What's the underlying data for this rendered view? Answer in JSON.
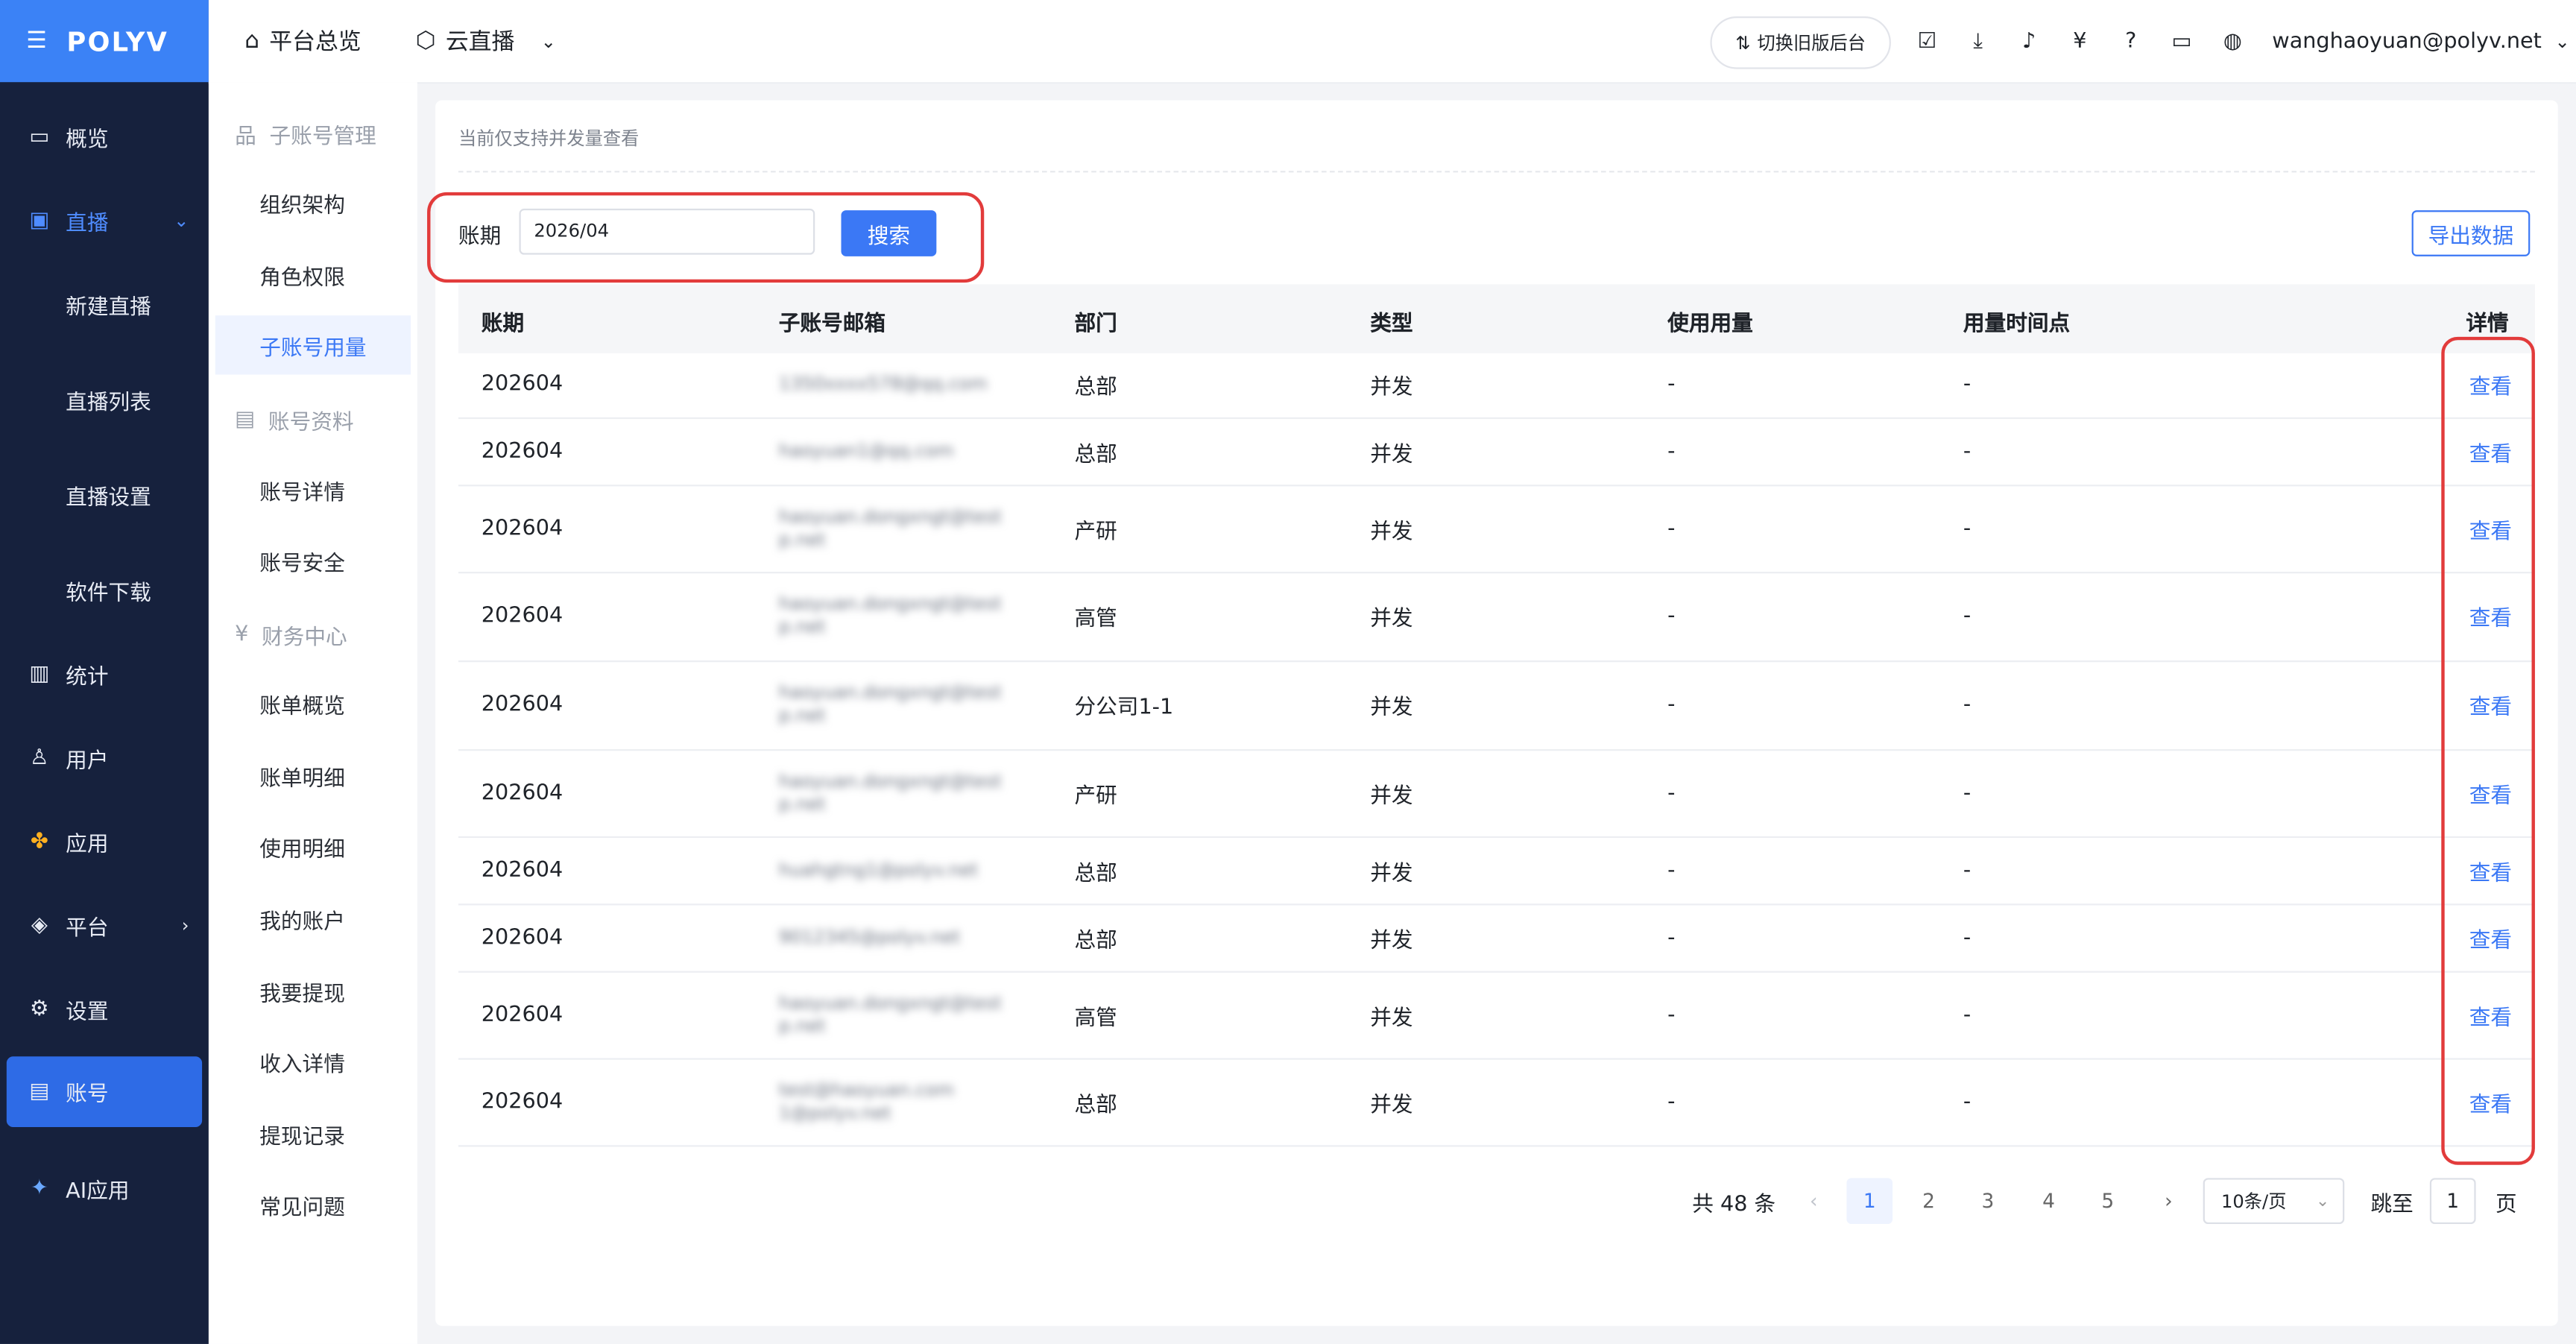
{
  "brand": {
    "logo": "POLYV",
    "menu_icon": "☰"
  },
  "sidebar": {
    "items": [
      {
        "label": "概览",
        "icon": "monitor-icon"
      },
      {
        "label": "直播",
        "icon": "video-icon"
      },
      {
        "label": "新建直播"
      },
      {
        "label": "直播列表"
      },
      {
        "label": "直播设置"
      },
      {
        "label": "软件下载"
      },
      {
        "label": "统计",
        "icon": "bar-chart-icon"
      },
      {
        "label": "用户",
        "icon": "user-icon"
      },
      {
        "label": "应用",
        "icon": "apps-icon"
      },
      {
        "label": "平台",
        "icon": "layers-icon"
      },
      {
        "label": "设置",
        "icon": "gear-icon"
      },
      {
        "label": "账号",
        "icon": "id-card-icon"
      },
      {
        "label": "AI应用",
        "icon": "sparkle-icon"
      }
    ]
  },
  "topbar": {
    "home_label": "平台总览",
    "product_label": "云直播",
    "switch_label": "切换旧版后台",
    "user_email": "wanghaoyuan@polyv.net"
  },
  "submenu": {
    "group1": "子账号管理",
    "group2": "账号资料",
    "group3": "财务中心",
    "items": [
      "组织架构",
      "角色权限",
      "子账号用量",
      "账号详情",
      "账号安全",
      "账单概览",
      "账单明细",
      "使用明细",
      "我的账户",
      "我要提现",
      "收入详情",
      "提现记录",
      "常见问题"
    ]
  },
  "main": {
    "notice": "当前仅支持并发量查看",
    "filter_label": "账期",
    "filter_value": "2026/04",
    "search_label": "搜索",
    "export_label": "导出数据",
    "columns": [
      "账期",
      "子账号邮箱",
      "部门",
      "类型",
      "使用用量",
      "用量时间点",
      "详情"
    ],
    "rows": [
      {
        "period": "202604",
        "email": "1350xxxx578@qq.com",
        "dept": "总部",
        "type": "并发",
        "usage": "-",
        "time": "-",
        "action": "查看"
      },
      {
        "period": "202604",
        "email": "haoyuan1@qq.com",
        "dept": "总部",
        "type": "并发",
        "usage": "-",
        "time": "-",
        "action": "查看"
      },
      {
        "period": "202604",
        "email": "haoyuan.dongxngt@test p.net",
        "dept": "产研",
        "type": "并发",
        "usage": "-",
        "time": "-",
        "action": "查看"
      },
      {
        "period": "202604",
        "email": "haoyuan.dongxngt@test p.net",
        "dept": "高管",
        "type": "并发",
        "usage": "-",
        "time": "-",
        "action": "查看"
      },
      {
        "period": "202604",
        "email": "haoyuan.dongxngt@test p.net",
        "dept": "分公司1-1",
        "type": "并发",
        "usage": "-",
        "time": "-",
        "action": "查看"
      },
      {
        "period": "202604",
        "email": "haoyuan.dongxngt@test p.net",
        "dept": "产研",
        "type": "并发",
        "usage": "-",
        "time": "-",
        "action": "查看"
      },
      {
        "period": "202604",
        "email": "huahgtng1@polyv.net",
        "dept": "总部",
        "type": "并发",
        "usage": "-",
        "time": "-",
        "action": "查看"
      },
      {
        "period": "202604",
        "email": "9012345@polyv.net",
        "dept": "总部",
        "type": "并发",
        "usage": "-",
        "time": "-",
        "action": "查看"
      },
      {
        "period": "202604",
        "email": "haoyuan.dongxngt@test p.net",
        "dept": "高管",
        "type": "并发",
        "usage": "-",
        "time": "-",
        "action": "查看"
      },
      {
        "period": "202604",
        "email": "test@haoyuan.com 1@polyv.net",
        "dept": "总部",
        "type": "并发",
        "usage": "-",
        "time": "-",
        "action": "查看"
      }
    ]
  },
  "pagination": {
    "total": "共 48 条",
    "pages": [
      "1",
      "2",
      "3",
      "4",
      "5"
    ],
    "prev": "‹",
    "next": "›",
    "page_size": "10条/页",
    "jump_label": "跳至",
    "jump_value": "1",
    "page_suffix": "页"
  },
  "colors": {
    "primary": "#3b78f5",
    "sidebar": "#16213d",
    "highlight_box": "#e23b3b"
  }
}
